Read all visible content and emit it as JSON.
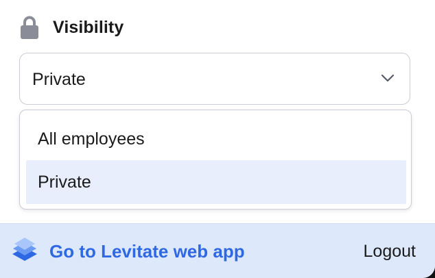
{
  "visibility": {
    "title": "Visibility",
    "icon": "lock-icon",
    "selected_value": "Private",
    "options": [
      {
        "label": "All employees",
        "highlighted": false
      },
      {
        "label": "Private",
        "highlighted": true
      }
    ]
  },
  "footer": {
    "webapp_link": "Go to Levitate web app",
    "logout_label": "Logout",
    "icon": "layers-icon"
  },
  "colors": {
    "accent": "#2f68e3",
    "footer_bg": "#dde8fb",
    "highlight_bg": "#e8eefc",
    "border": "#c9ccd6",
    "icon_gray": "#8a8d97"
  }
}
